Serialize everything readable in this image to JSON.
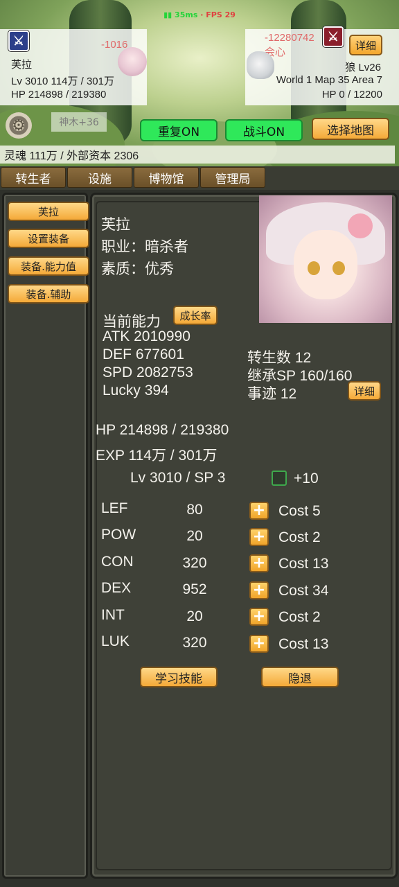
{
  "status": {
    "ping": "35ms",
    "fps": "FPS 29"
  },
  "player": {
    "name": "芙拉",
    "damage": "-1016",
    "level_line": "Lv 3010 114万 / 301万",
    "hp_line": "HP 214898 / 219380",
    "class_icon": "assassin-class-icon"
  },
  "enemy": {
    "damage": "-12280742",
    "crit": "会心",
    "name": "狼 Lv26",
    "location": "World 1 Map 35 Area 7",
    "hp_line": "HP 0 / 12200",
    "detail_label": "详细",
    "class_icon": "warrior-class-icon"
  },
  "controls": {
    "shenmu": "神木+36",
    "repeat_label": "重复ON",
    "battle_label": "战斗ON",
    "map_label": "选择地图",
    "soul_line": "灵魂 111万 / 外部资本 2306"
  },
  "tabs": [
    "转生者",
    "设施",
    "博物馆",
    "管理局"
  ],
  "sidebar": [
    "芙拉",
    "设置装备",
    "装备.能力值",
    "装备.辅助"
  ],
  "profile": {
    "name": "芙拉",
    "job": "职业：暗杀者",
    "quality": "素质：优秀",
    "current_ability": "当前能力",
    "growth_label": "成长率",
    "atk": "ATK 2010990",
    "def": "DEF 677601",
    "spd": "SPD 2082753",
    "lucky": "Lucky 394",
    "rebirth": "转生数 12",
    "inherit_sp": "继承SP 160/160",
    "deeds": "事迹 12",
    "detail_label": "详细",
    "hp": "HP 214898 / 219380",
    "exp": "EXP 114万 / 301万",
    "lv_sp": "Lv 3010 / SP 3",
    "plus_ten": "+10"
  },
  "stats": [
    {
      "name": "LEF",
      "value": "80",
      "cost": "Cost 5"
    },
    {
      "name": "POW",
      "value": "20",
      "cost": "Cost 2"
    },
    {
      "name": "CON",
      "value": "320",
      "cost": "Cost 13"
    },
    {
      "name": "DEX",
      "value": "952",
      "cost": "Cost 34"
    },
    {
      "name": "INT",
      "value": "20",
      "cost": "Cost 2"
    },
    {
      "name": "LUK",
      "value": "320",
      "cost": "Cost 13"
    }
  ],
  "actions": {
    "learn_skill": "学习技能",
    "retire": "隐退"
  },
  "colors": {
    "accent_orange": "#f4a938",
    "toggle_green": "#2fe85a",
    "damage_red": "#e06a6a"
  }
}
